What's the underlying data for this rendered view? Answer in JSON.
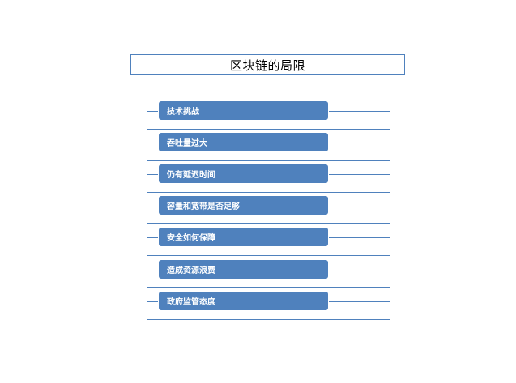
{
  "title": "区块链的局限",
  "items": [
    {
      "label": "技术挑战"
    },
    {
      "label": "吞吐量过大"
    },
    {
      "label": "仍有延迟时间"
    },
    {
      "label": "容量和宽带是否足够"
    },
    {
      "label": "安全如何保障"
    },
    {
      "label": "造成资源浪费"
    },
    {
      "label": "政府监管态度"
    }
  ],
  "colors": {
    "accent": "#4f81bd",
    "label_text": "#ffffff",
    "title_text": "#000000"
  }
}
